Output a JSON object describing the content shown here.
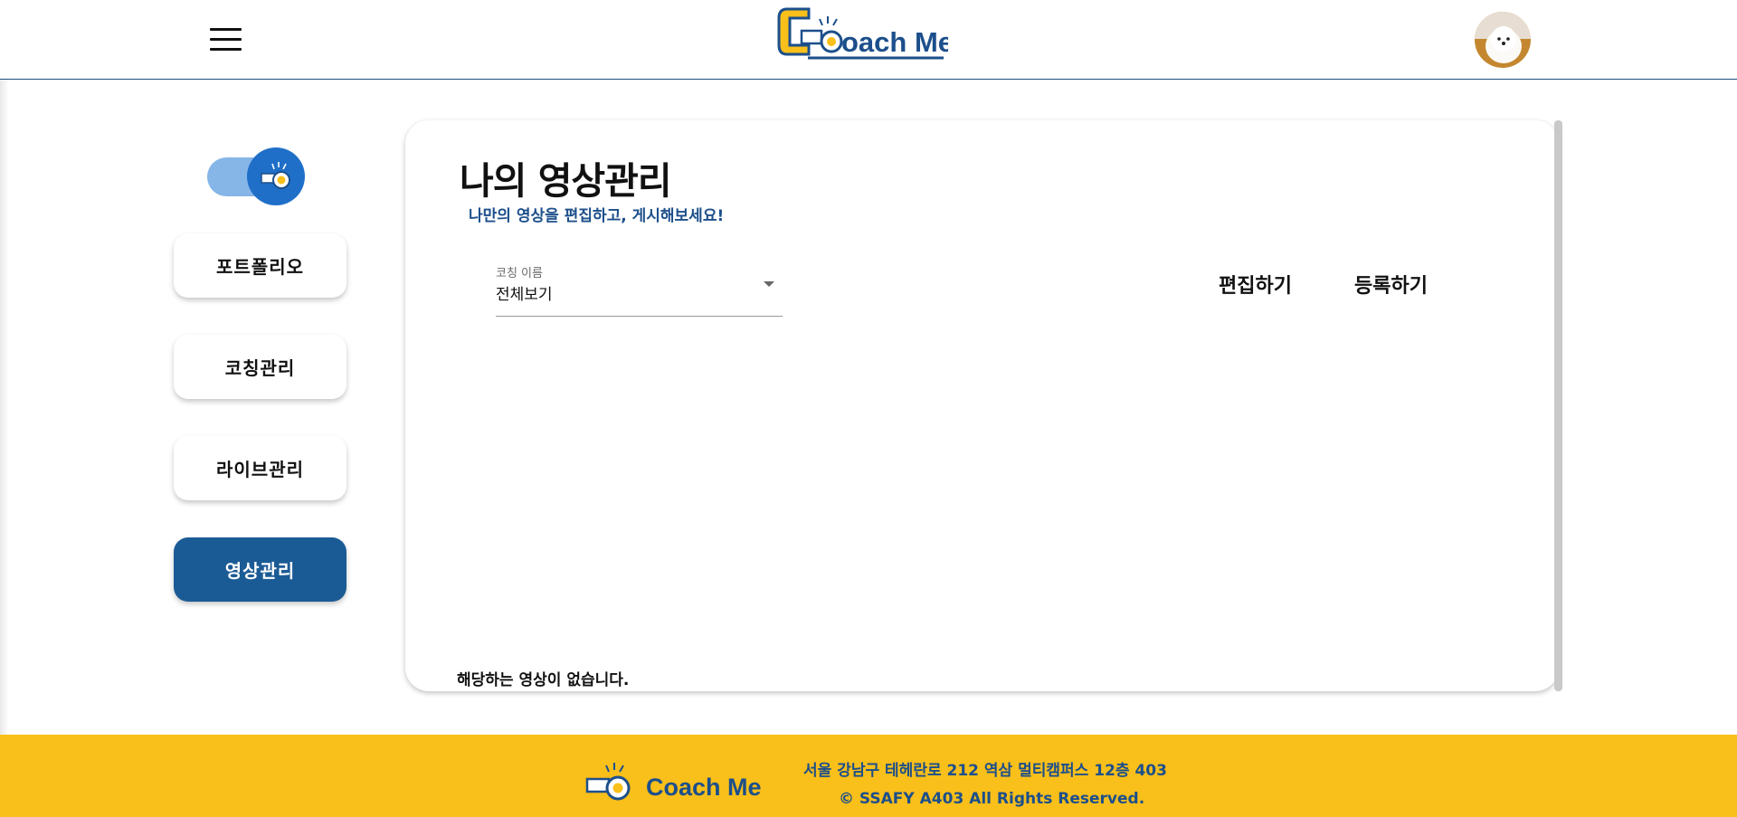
{
  "header": {
    "brand": "Coach Me",
    "menu_icon": "hamburger-menu-icon",
    "avatar_icon": "profile-avatar"
  },
  "sidebar": {
    "toggle_icon": "whistle-icon",
    "items": [
      {
        "label": "포트폴리오",
        "active": false
      },
      {
        "label": "코칭관리",
        "active": false
      },
      {
        "label": "라이브관리",
        "active": false
      },
      {
        "label": "영상관리",
        "active": true
      }
    ]
  },
  "main": {
    "title": "나의 영상관리",
    "subtitle": "나만의 영상을 편집하고, 게시해보세요!",
    "filter": {
      "label": "코칭 이름",
      "value": "전체보기"
    },
    "actions": {
      "edit": "편집하기",
      "register": "등록하기"
    },
    "empty_message": "해당하는 영상이 없습니다."
  },
  "footer": {
    "brand": "Coach Me",
    "address": "서울 강남구 테헤란로 212 역삼 멀티캠퍼스 12층 403",
    "copyright": "© SSAFY A403 All Rights Reserved."
  },
  "colors": {
    "primary": "#1b5b95",
    "brand_blue": "#1c4f8b",
    "accent_yellow": "#f9bf1a",
    "toggle_track": "#86b5e8",
    "toggle_knob": "#1f6fc8"
  }
}
